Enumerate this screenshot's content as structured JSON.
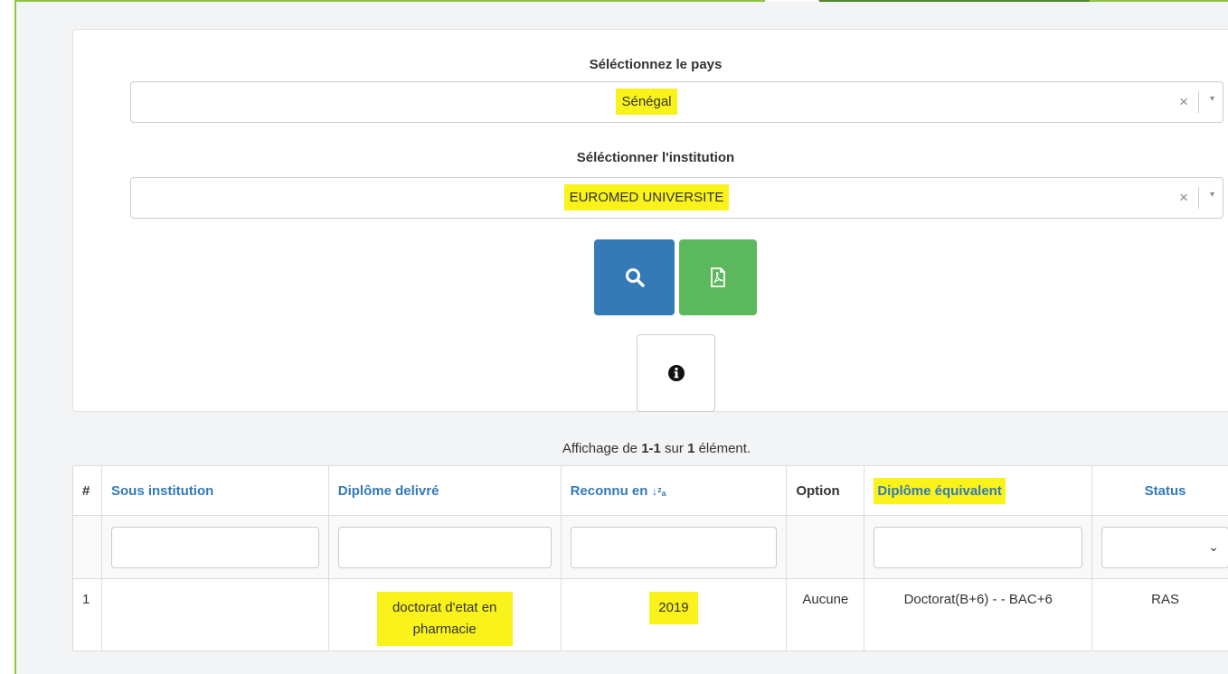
{
  "form": {
    "country_label": "Séléctionnez le pays",
    "country_value": "Sénégal",
    "institution_label": "Séléctionner l'institution",
    "institution_value": "EUROMED UNIVERSITE",
    "clear_glyph": "×",
    "arrow_glyph": "▾"
  },
  "buttons": {
    "search_icon": "search-icon",
    "pdf_icon": "pdf-icon",
    "info_icon": "info-icon"
  },
  "summary": {
    "prefix": "Affichage de ",
    "range": "1-1",
    "middle": " sur ",
    "total": "1",
    "suffix": " élément."
  },
  "table": {
    "columns": {
      "num": "#",
      "sous_institution": "Sous institution",
      "diplome_delivre": "Diplôme delivré",
      "reconnu_en": "Reconnu en",
      "option": "Option",
      "diplome_equivalent": "Diplôme équivalent",
      "status": "Status"
    },
    "rows": [
      {
        "num": "1",
        "sous_institution": "",
        "diplome_delivre": "doctorat d'etat en pharmacie",
        "reconnu_en": "2019",
        "option": "Aucune",
        "diplome_equivalent": "Doctorat(B+6) - - BAC+6",
        "status": "RAS"
      }
    ]
  },
  "colors": {
    "primary": "#337ab7",
    "success": "#5cb85c",
    "highlight": "#f9f21b",
    "frame_green": "#8dc63f",
    "frame_dark_green": "#4e8a2a"
  }
}
